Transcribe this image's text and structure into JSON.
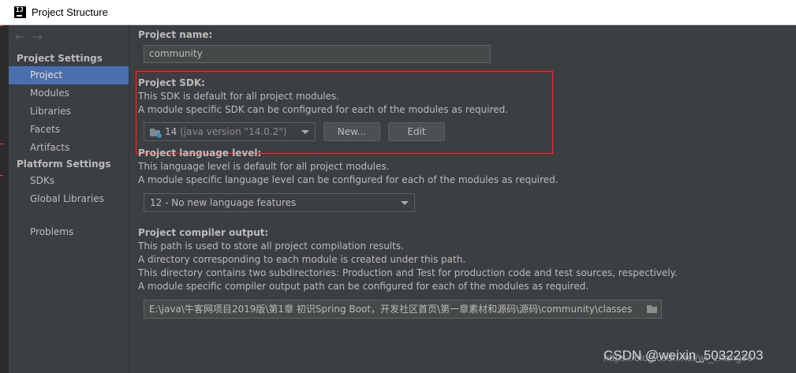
{
  "window": {
    "title": "Project Structure",
    "logo_text": "IJ"
  },
  "sidebar": {
    "project_settings_heading": "Project Settings",
    "project_settings_items": [
      {
        "label": "Project",
        "selected": true
      },
      {
        "label": "Modules"
      },
      {
        "label": "Libraries"
      },
      {
        "label": "Facets"
      },
      {
        "label": "Artifacts"
      }
    ],
    "platform_settings_heading": "Platform Settings",
    "platform_settings_items": [
      {
        "label": "SDKs"
      },
      {
        "label": "Global Libraries"
      }
    ],
    "problems_label": "Problems",
    "nav_back": "←",
    "nav_forward": "→"
  },
  "project_name": {
    "label": "Project name:",
    "value": "community"
  },
  "project_sdk": {
    "label": "Project SDK:",
    "desc1": "This SDK is default for all project modules.",
    "desc2": "A module specific SDK can be configured for each of the modules as required.",
    "selected_version": "14",
    "selected_detail": "(java version \"14.0.2\")",
    "new_button": "New...",
    "edit_button": "Edit"
  },
  "language_level": {
    "label": "Project language level:",
    "desc1": "This language level is default for all project modules.",
    "desc2": "A module specific language level can be configured for each of the modules as required.",
    "selected": "12 - No new language features"
  },
  "compiler_output": {
    "label": "Project compiler output:",
    "desc1": "This path is used to store all project compilation results.",
    "desc2": "A directory corresponding to each module is created under this path.",
    "desc3": "This directory contains two subdirectories: Production and Test for production code and test sources, respectively.",
    "desc4": "A module specific compiler output path can be configured for each of the modules as required.",
    "path": "E:\\java\\牛客网项目2019版\\第1章 初识Spring Boot，开发社区首页\\第一章素材和源码\\源码\\community\\classes"
  },
  "watermark": {
    "csdn": "CSDN @weixin_50322203",
    "url": "https://blog.csdn.net/wi_zhang36"
  },
  "colors": {
    "background": "#3c3f41",
    "selection": "#4b6eaf",
    "highlight_box": "#e0353b"
  },
  "icons": {
    "logo": "intellij-logo-icon",
    "sdk": "folder-sdk-icon",
    "browse": "folder-browse-icon"
  }
}
